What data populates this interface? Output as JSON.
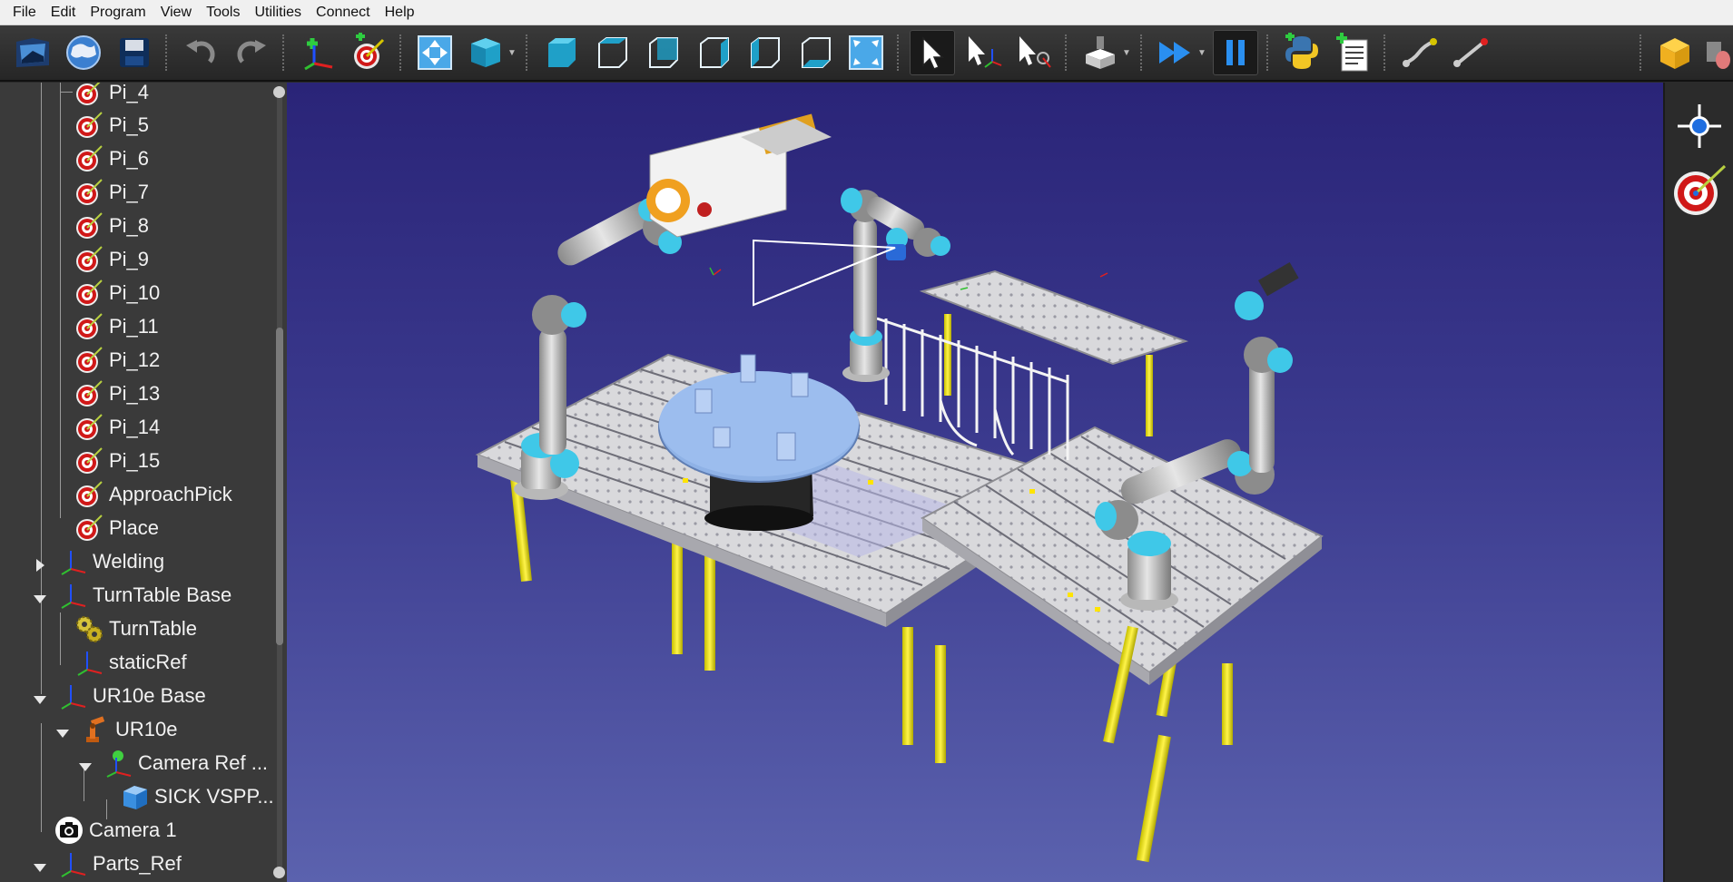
{
  "menu": [
    "File",
    "Edit",
    "Program",
    "View",
    "Tools",
    "Utilities",
    "Connect",
    "Help"
  ],
  "toolbar": {
    "icons": [
      "open-station-icon",
      "online-library-icon",
      "save-icon",
      "undo-icon",
      "redo-icon",
      "add-reference-frame-icon",
      "add-target-icon",
      "fit-all-icon",
      "view-iso-icon",
      "view-front-icon",
      "view-top-icon",
      "view-back-icon",
      "view-right-icon",
      "view-left-icon",
      "view-bottom-icon",
      "fit-selection-icon",
      "select-pointer-icon",
      "move-reference-icon",
      "move-tcp-icon",
      "simulate-tool-icon",
      "fast-simulation-icon",
      "pause-simulation-icon",
      "add-python-program-icon",
      "add-program-icon",
      "add-move-joint-icon",
      "add-move-linear-icon",
      "add-package-icon",
      "more-icon"
    ]
  },
  "tree": {
    "items": [
      {
        "label": "Pi_4",
        "icon": "target-icon"
      },
      {
        "label": "Pi_5",
        "icon": "target-icon"
      },
      {
        "label": "Pi_6",
        "icon": "target-icon"
      },
      {
        "label": "Pi_7",
        "icon": "target-icon"
      },
      {
        "label": "Pi_8",
        "icon": "target-icon"
      },
      {
        "label": "Pi_9",
        "icon": "target-icon"
      },
      {
        "label": "Pi_10",
        "icon": "target-icon"
      },
      {
        "label": "Pi_11",
        "icon": "target-icon"
      },
      {
        "label": "Pi_12",
        "icon": "target-icon"
      },
      {
        "label": "Pi_13",
        "icon": "target-icon"
      },
      {
        "label": "Pi_14",
        "icon": "target-icon"
      },
      {
        "label": "Pi_15",
        "icon": "target-icon"
      },
      {
        "label": "ApproachPick",
        "icon": "target-icon"
      },
      {
        "label": "Place",
        "icon": "target-icon"
      },
      {
        "label": "Welding",
        "icon": "reference-frame-icon",
        "state": "collapsed"
      },
      {
        "label": "TurnTable Base",
        "icon": "reference-frame-icon",
        "state": "expanded"
      },
      {
        "label": "TurnTable",
        "icon": "mechanism-icon"
      },
      {
        "label": "staticRef",
        "icon": "reference-frame-icon"
      },
      {
        "label": "UR10e Base",
        "icon": "reference-frame-icon",
        "state": "expanded"
      },
      {
        "label": "UR10e",
        "icon": "robot-icon",
        "state": "expanded"
      },
      {
        "label": "Camera Ref ...",
        "icon": "reference-frame-icon",
        "state": "expanded"
      },
      {
        "label": "SICK VSPP...",
        "icon": "object-icon"
      },
      {
        "label": "Camera 1",
        "icon": "camera-icon"
      },
      {
        "label": "Parts_Ref",
        "icon": "reference-frame-icon",
        "state": "expanded"
      }
    ]
  },
  "right_dock": {
    "icons": [
      "reference-frame-tool-icon",
      "target-tool-icon"
    ]
  },
  "colors": {
    "viewport_top": "#2a2478",
    "viewport_bottom": "#5b62ae",
    "robot_accent": "#3fc8e8",
    "table_legs": "#e6e000",
    "turntable_top": "#8fb2e6"
  }
}
